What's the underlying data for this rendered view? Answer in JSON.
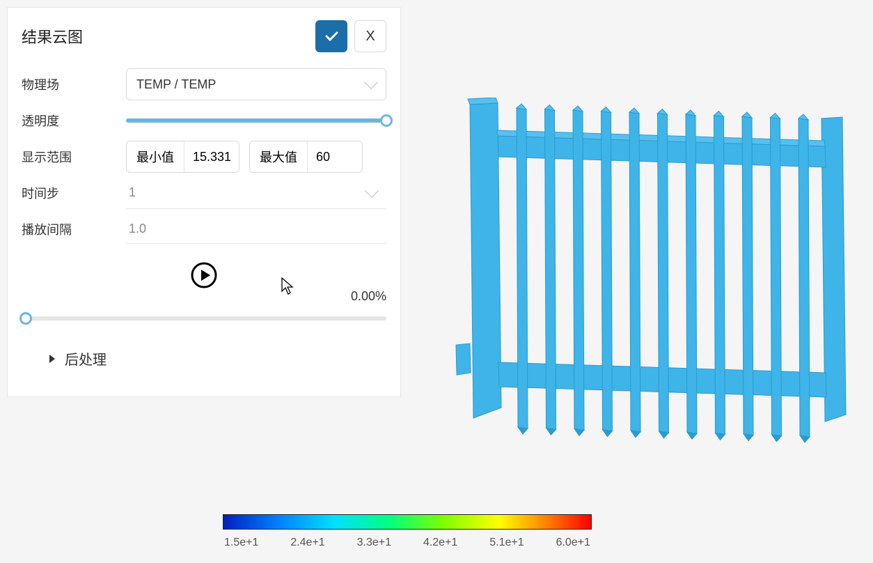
{
  "panel": {
    "title": "结果云图",
    "ok": "✓",
    "close": "X",
    "field_label": "物理场",
    "field_value": "TEMP / TEMP",
    "opacity_label": "透明度",
    "range_label": "显示范围",
    "min_label": "最小值",
    "min_value": "15.331",
    "max_label": "最大值",
    "max_value": "60",
    "timestep_label": "时间步",
    "timestep_value": "1",
    "interval_label": "播放间隔",
    "interval_value": "1.0",
    "progress": "0.00%",
    "postprocess": "后处理"
  },
  "chart_data": {
    "type": "colormap_legend",
    "title": "TEMP",
    "range": [
      15.331,
      60
    ],
    "ticks": [
      "1.5e+1",
      "2.4e+1",
      "3.3e+1",
      "4.2e+1",
      "5.1e+1",
      "6.0e+1"
    ],
    "colormap": "rainbow",
    "model_color_approx": "#3eb4e8",
    "note": "3D heatsink/fence model rendered uniformly near low end of scale (~15°C)"
  }
}
